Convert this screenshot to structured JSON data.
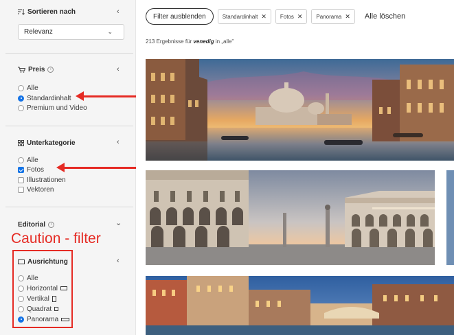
{
  "sidebar": {
    "sort": {
      "label": "Sortieren nach",
      "selected": "Relevanz"
    },
    "price": {
      "label": "Preis",
      "options": [
        {
          "label": "Alle",
          "selected": false
        },
        {
          "label": "Standardinhalt",
          "selected": true
        },
        {
          "label": "Premium und Video",
          "selected": false
        }
      ]
    },
    "subcategory": {
      "label": "Unterkategorie",
      "options": [
        {
          "label": "Alle",
          "checked": false
        },
        {
          "label": "Fotos",
          "checked": true
        },
        {
          "label": "Illustrationen",
          "checked": false
        },
        {
          "label": "Vektoren",
          "checked": false
        }
      ]
    },
    "editorial": {
      "label": "Editorial"
    },
    "orientation": {
      "label": "Ausrichtung",
      "options": [
        {
          "label": "Alle",
          "selected": false
        },
        {
          "label": "Horizontal",
          "selected": false
        },
        {
          "label": "Vertikal",
          "selected": false
        },
        {
          "label": "Quadrat",
          "selected": false
        },
        {
          "label": "Panorama",
          "selected": true
        }
      ]
    }
  },
  "annotation": {
    "text": "Caution - filter",
    "color": "#e52b24"
  },
  "toolbar": {
    "hide_filters": "Filter ausblenden",
    "chips": [
      "Standardinhalt",
      "Fotos",
      "Panorama"
    ],
    "clear_all": "Alle löschen"
  },
  "results": {
    "count": "213",
    "prefix": "Ergebnisse für",
    "query": "venedig",
    "suffix": "in „alle\""
  },
  "colors": {
    "accent": "#1473e6",
    "sidebar_bg": "#f5f5f5"
  }
}
